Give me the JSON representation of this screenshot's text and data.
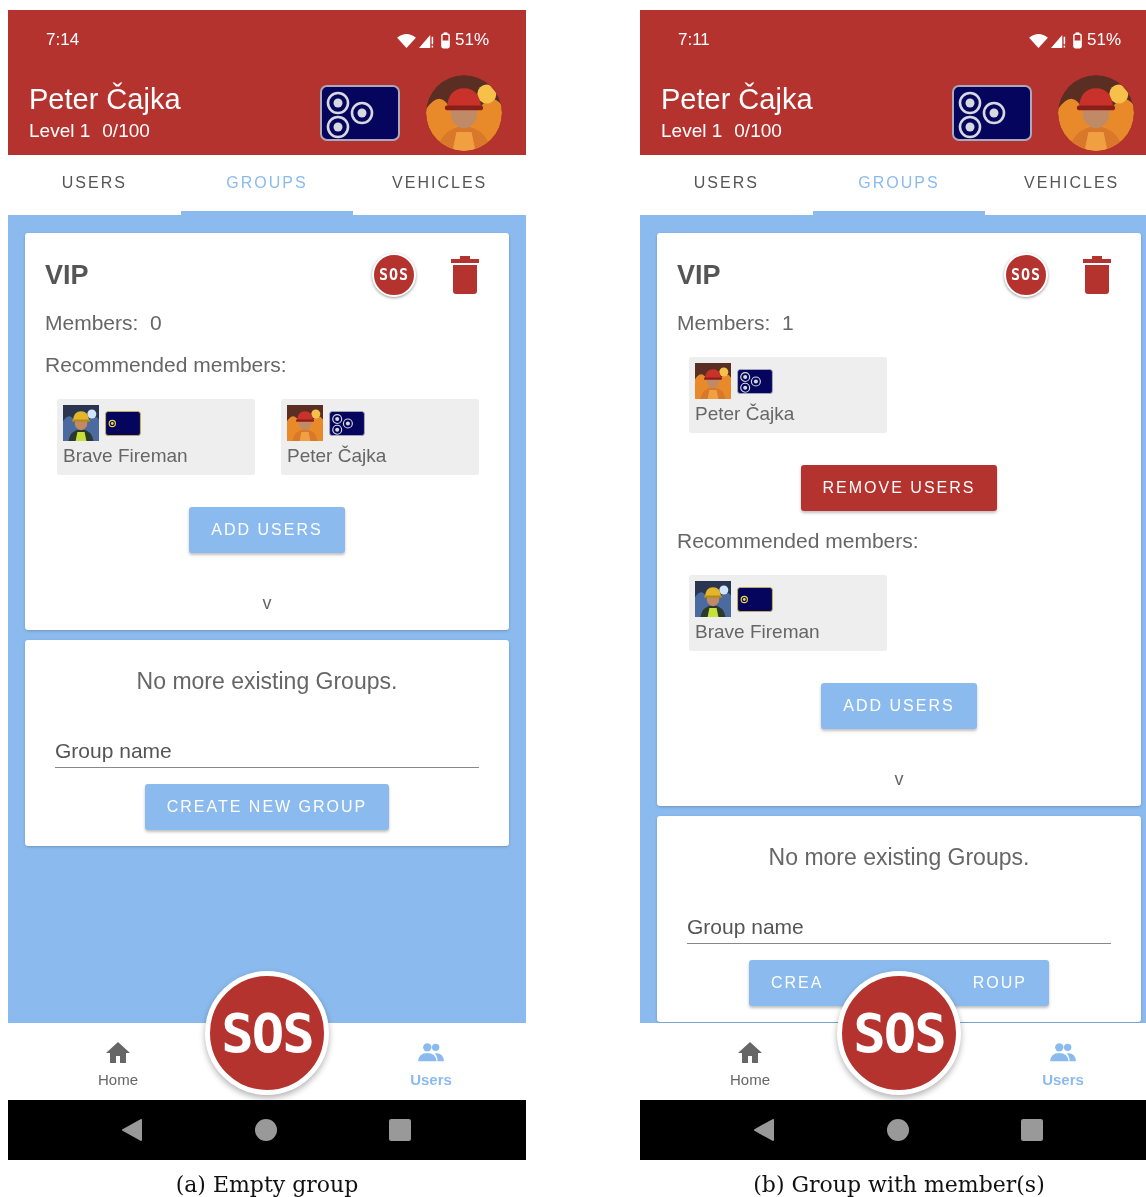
{
  "screens": [
    {
      "status_bar": {
        "time": "7:14",
        "battery": "51%"
      },
      "header": {
        "name": "Peter Čajka",
        "level": "Level 1",
        "xp": "0/100",
        "kind": "triple"
      },
      "tabs": [
        {
          "label": "USERS",
          "selected": false
        },
        {
          "label": "GROUPS",
          "selected": true
        },
        {
          "label": "VEHICLES",
          "selected": false
        }
      ],
      "group": {
        "title": "VIP",
        "sos_label": "SOS",
        "members_label": "Members:",
        "members_count": "0",
        "recommended_label": "Recommended members:",
        "recommended": [
          {
            "name": "Brave Fireman",
            "kind": "single"
          },
          {
            "name": "Peter Čajka",
            "kind": "triple"
          }
        ],
        "add_button": "ADD USERS",
        "expand": "v"
      },
      "new_group": {
        "message": "No more existing Groups.",
        "placeholder": "Group name",
        "create_button": [
          "CREATE NEW GROUP"
        ]
      },
      "sos_button": "SOS",
      "nav": [
        {
          "label": "Home",
          "kind": "home",
          "selected": false
        },
        {
          "label": "Users",
          "kind": "users",
          "selected": true
        }
      ],
      "caption": "(a) Empty group"
    },
    {
      "status_bar": {
        "time": "7:11",
        "battery": "51%"
      },
      "header": {
        "name": "Peter Čajka",
        "level": "Level 1",
        "xp": "0/100",
        "kind": "triple"
      },
      "tabs": [
        {
          "label": "USERS",
          "selected": false
        },
        {
          "label": "GROUPS",
          "selected": true
        },
        {
          "label": "VEHICLES",
          "selected": false
        }
      ],
      "group": {
        "title": "VIP",
        "sos_label": "SOS",
        "members_label": "Members:",
        "members_count": "1",
        "members": [
          {
            "name": "Peter Čajka",
            "kind": "triple"
          }
        ],
        "remove_button": "REMOVE USERS",
        "recommended_label": "Recommended members:",
        "recommended": [
          {
            "name": "Brave Fireman",
            "kind": "single"
          }
        ],
        "add_button": "ADD USERS",
        "expand": "v"
      },
      "new_group": {
        "message": "No more existing Groups.",
        "placeholder": "Group name",
        "create_button": [
          "CREA",
          "ROUP"
        ]
      },
      "sos_button": "SOS",
      "nav": [
        {
          "label": "Home",
          "kind": "home",
          "selected": false
        },
        {
          "label": "Users",
          "kind": "users",
          "selected": true
        }
      ],
      "caption": "(b) Group with member(s)"
    }
  ]
}
